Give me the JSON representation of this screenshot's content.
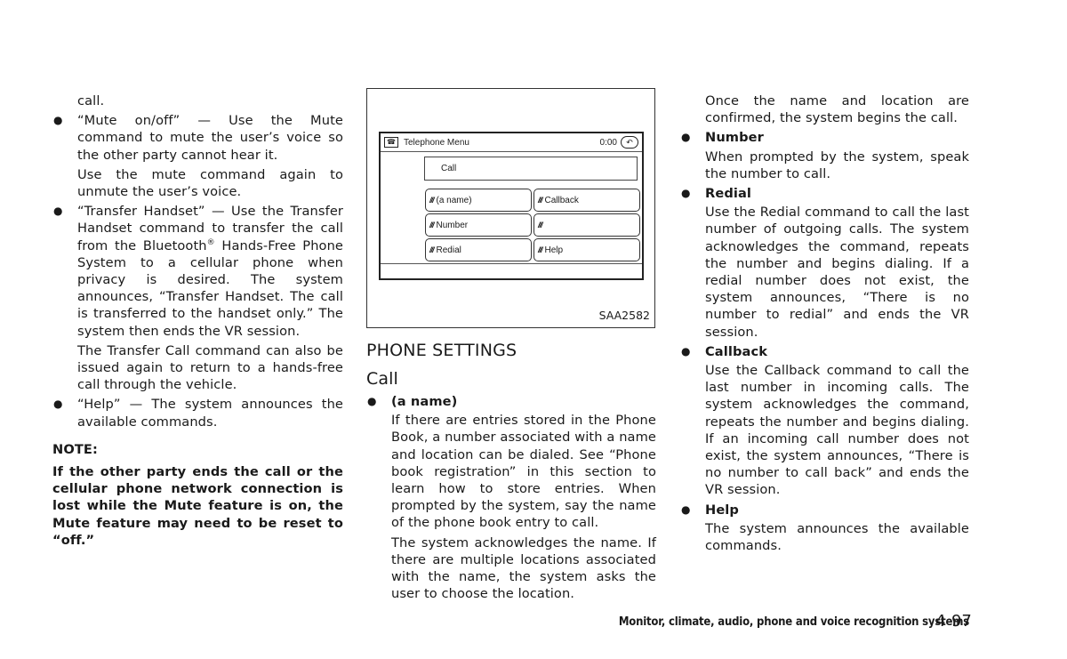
{
  "left_column": {
    "continuation": "call.",
    "bullets": [
      {
        "paragraphs": [
          "“Mute on/off” — Use the Mute command to mute the user’s voice so the other party cannot hear it.",
          "Use the mute command again to unmute the user’s voice."
        ]
      },
      {
        "paragraphs_html_parts": {
          "p1_before_sup": "“Transfer Handset” — Use the Transfer Handset command to transfer the call from the Bluetooth",
          "sup": "®",
          "p1_after_sup": " Hands-Free Phone System to a cellular phone when privacy is desired. The system announces, “Transfer Handset. The call is transferred to the handset only.” The system then ends the VR session."
        },
        "paragraphs": [
          "The Transfer Call command can also be issued again to return to a hands-free call through the vehicle."
        ]
      },
      {
        "paragraphs": [
          "“Help” — The system announces the available commands."
        ]
      }
    ],
    "note_label": "NOTE:",
    "note_body": "If the other party ends the call or the cellular phone network connection is lost while the Mute feature is on, the Mute feature may need to be reset to “off.”"
  },
  "figure": {
    "screen_title": "Telephone Menu",
    "timer": "0:00",
    "call_label": "Call",
    "buttons": [
      "(a name)",
      "Callback",
      "Number",
      "",
      "Redial",
      "Help"
    ],
    "figure_id": "SAA2582"
  },
  "middle_column": {
    "section_heading": "PHONE SETTINGS",
    "sub_heading": "Call",
    "bullet_head": "(a name)",
    "paragraphs": [
      "If there are entries stored in the Phone Book, a number associated with a name and location can be dialed. See “Phone book registration” in this section to learn how to store entries. When prompted by the system, say the name of the phone book entry to call.",
      "The system acknowledges the name. If there are multiple locations associated with the name, the system asks the user to choose the location."
    ]
  },
  "right_column": {
    "continuation": "Once the name and location are confirmed, the system begins the call.",
    "bullets": [
      {
        "head": "Number",
        "body": "When prompted by the system, speak the number to call."
      },
      {
        "head": "Redial",
        "body": "Use the Redial command to call the last number of outgoing calls. The system acknowledges the command, repeats the number and begins dialing. If a redial number does not exist, the system announces, “There is no number to redial” and ends the VR session."
      },
      {
        "head": "Callback",
        "body": "Use the Callback command to call the last number in incoming calls. The system acknowledges the command, repeats the number and begins dialing. If an incoming call number does not exist, the system announces, “There is no number to call back” and ends the VR session."
      },
      {
        "head": "Help",
        "body": "The system announces the available commands."
      }
    ]
  },
  "footer": {
    "chapter_title": "Monitor, climate, audio, phone and voice recognition systems",
    "page_number": "4-97"
  },
  "icons": {
    "bullet": "●",
    "phone": "☎",
    "back": "↶",
    "voice": "///"
  }
}
